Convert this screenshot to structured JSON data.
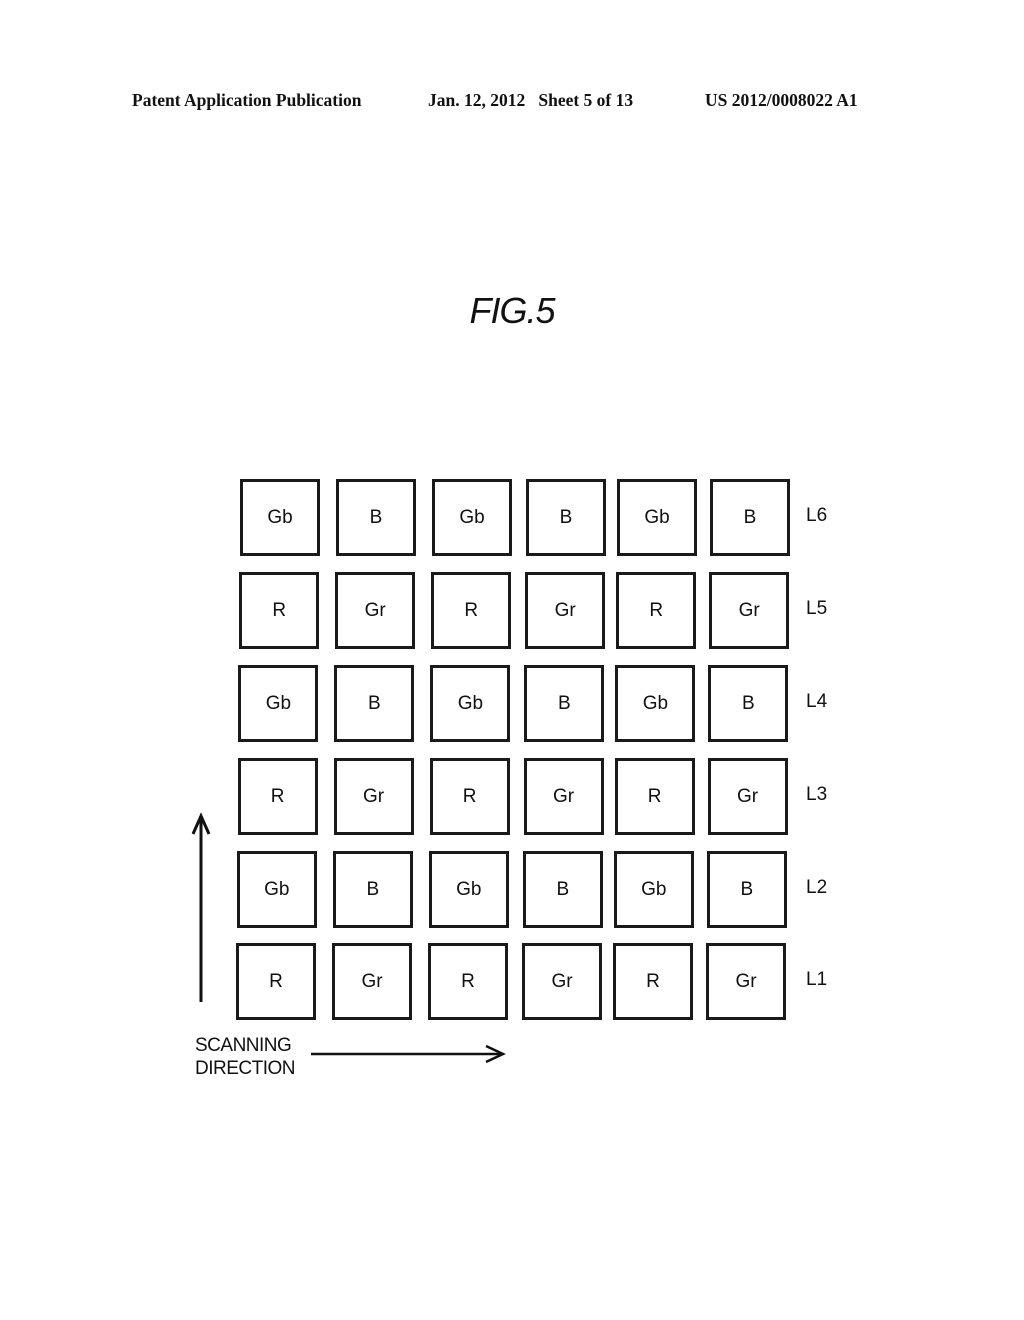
{
  "header": {
    "publication": "Patent Application Publication",
    "date_sheet": "Jan. 12, 2012   Sheet 5 of 13",
    "number": "US 2012/0008022 A1"
  },
  "figure": {
    "title": "FIG.5",
    "rows": [
      {
        "label": "L6",
        "cells": [
          "Gb",
          "B",
          "Gb",
          "B",
          "Gb",
          "B"
        ]
      },
      {
        "label": "L5",
        "cells": [
          "R",
          "Gr",
          "R",
          "Gr",
          "R",
          "Gr"
        ]
      },
      {
        "label": "L4",
        "cells": [
          "Gb",
          "B",
          "Gb",
          "B",
          "Gb",
          "B"
        ]
      },
      {
        "label": "L3",
        "cells": [
          "R",
          "Gr",
          "R",
          "Gr",
          "R",
          "Gr"
        ]
      },
      {
        "label": "L2",
        "cells": [
          "Gb",
          "B",
          "Gb",
          "B",
          "Gb",
          "B"
        ]
      },
      {
        "label": "L1",
        "cells": [
          "R",
          "Gr",
          "R",
          "Gr",
          "R",
          "Gr"
        ]
      }
    ],
    "scan_label_line1": "SCANNING",
    "scan_label_line2": "DIRECTION",
    "vertical_arrow_icon": "arrow-up-icon",
    "horizontal_arrow_icon": "arrow-right-icon"
  }
}
